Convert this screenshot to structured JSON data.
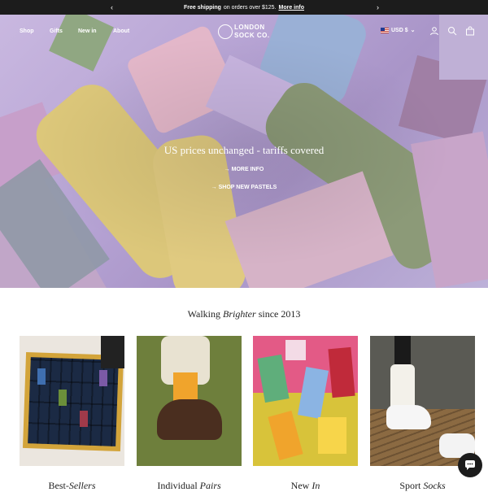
{
  "announcement": {
    "bold": "Free shipping",
    "text": "on orders over $125.",
    "link": "More info",
    "prev_icon": "chevron-left-icon",
    "next_icon": "chevron-right-icon"
  },
  "nav": {
    "links": [
      "Shop",
      "Gifts",
      "New in",
      "About"
    ],
    "logo_line1": "LONDON",
    "logo_line2": "SOCK CO.",
    "currency": "USD $",
    "icons": [
      "user-icon",
      "search-icon",
      "bag-icon"
    ]
  },
  "hero": {
    "title": "US prices unchanged - tariffs covered",
    "link1": "MORE INFO",
    "link2": "SHOP NEW PASTELS"
  },
  "tagline": {
    "pre": "Walking ",
    "em": "Brighter",
    "post": " since 2013"
  },
  "categories": [
    {
      "pre": "Best-",
      "em": "Sellers"
    },
    {
      "pre": "Individual ",
      "em": "Pairs"
    },
    {
      "pre": "New ",
      "em": "In"
    },
    {
      "pre": "Sport ",
      "em": "Socks"
    }
  ],
  "colors": {
    "bar": "#1c1c1c",
    "hero_purple": "#b5a2d3",
    "sock_yellow": "#dcc77a",
    "sock_green": "#8c9a78",
    "sock_blue": "#9ab0d6",
    "sock_pink": "#e3b7c9"
  }
}
